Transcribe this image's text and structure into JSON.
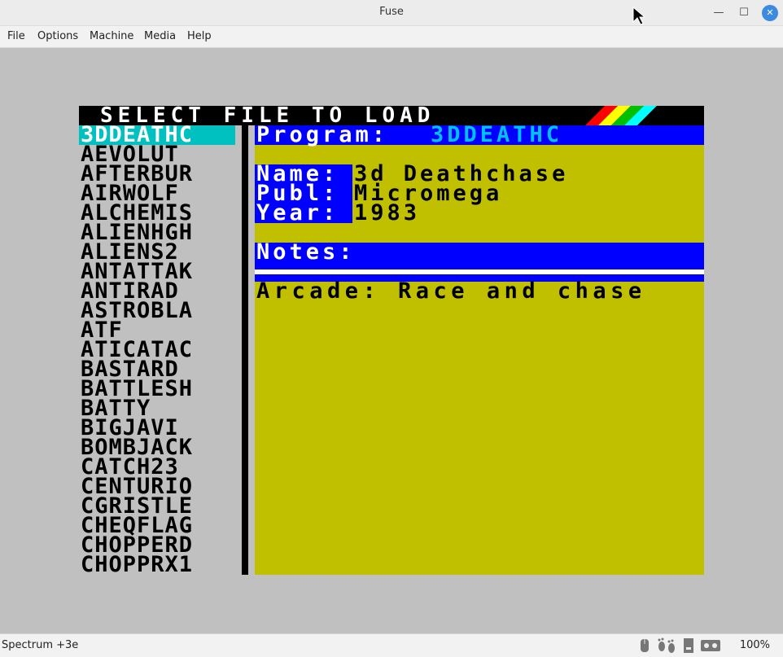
{
  "window": {
    "title": "Fuse",
    "minimize_glyph": "—",
    "maximize_glyph": "☐",
    "close_glyph": "✕"
  },
  "menu": [
    "File",
    "Options",
    "Machine",
    "Media",
    "Help"
  ],
  "screen": {
    "header": "SELECT FILE TO LOAD",
    "files": [
      "3DDEATHC",
      "AEVOLUT",
      "AFTERBUR",
      "AIRWOLF",
      "ALCHEMIS",
      "ALIENHGH",
      "ALIENS2",
      "ANTATTAK",
      "ANTIRAD",
      "ASTROBLA",
      "ATF",
      "ATICATAC",
      "BASTARD",
      "BATTLESH",
      "BATTY",
      "BIGJAVI",
      "BOMBJACK",
      "CATCH23",
      "CENTURIO",
      "CGRISTLE",
      "CHEQFLAG",
      "CHOPPERD",
      "CHOPPRX1"
    ],
    "selected_index": 0,
    "program_label": "Program:",
    "program_value": "3DDEATHC",
    "name_label": "Name:",
    "name_value": "3d Deathchase",
    "publ_label": "Publ:",
    "publ_value": "Micromega",
    "year_label": "Year:",
    "year_value": "1983",
    "notes_label": "Notes:",
    "notes_text": "Arcade: Race and chase"
  },
  "colors": {
    "selection": "#00c0c0",
    "panel_yellow": "#c0c000",
    "bar_blue": "#0000ff",
    "program_cyan": "#00c0ff"
  },
  "status": {
    "machine": "Spectrum +3e",
    "zoom": "100%",
    "icons": [
      "mouse-icon",
      "footprints-icon",
      "disk-drive-icon",
      "tape-icon"
    ]
  }
}
